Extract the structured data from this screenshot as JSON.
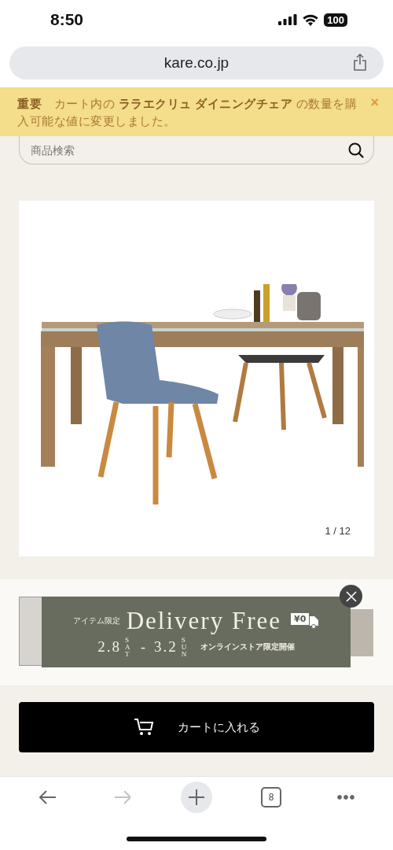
{
  "status_bar": {
    "time": "8:50",
    "battery": "100"
  },
  "address_bar": {
    "url": "kare.co.jp"
  },
  "notice": {
    "message": "**重要**　カート内の **ララエクリュ ダイニングチェア** の数量を購入可能な値に変更しました。",
    "close": "×"
  },
  "search": {
    "placeholder": "商品検索"
  },
  "gallery": {
    "counter": "1 / 12"
  },
  "promo": {
    "tag": "アイテム限定",
    "headline": "Delivery Free",
    "badge": "¥0",
    "dates": [
      {
        "date": "2.8",
        "day": "SAT"
      },
      {
        "date": "3.2",
        "day": "SUN"
      }
    ],
    "separator": "-",
    "note": "オンラインストア限定開催"
  },
  "cart_button": {
    "label": "カートに入れる"
  },
  "toolbar": [
    {
      "kind": "back",
      "disabled": false
    },
    {
      "kind": "forward",
      "disabled": true
    },
    {
      "kind": "new-tab",
      "disabled": false
    },
    {
      "kind": "tabs",
      "count": "8",
      "disabled": false
    },
    {
      "kind": "more",
      "disabled": false
    }
  ]
}
